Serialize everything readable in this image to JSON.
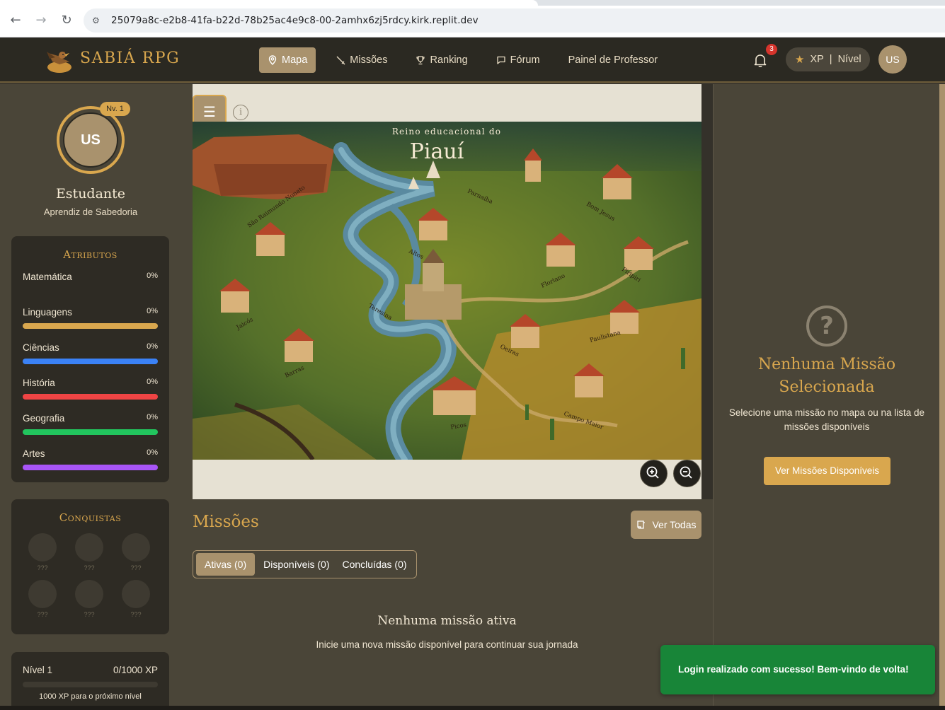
{
  "browser": {
    "url": "25079a8c-e2b8-41fa-b22d-78b25ac4e9c8-00-2amhx6zj5rdcy.kirk.replit.dev"
  },
  "header": {
    "brand": "SABIÁ RPG",
    "nav": [
      {
        "label": "Mapa",
        "icon": "map-pin-icon",
        "active": true
      },
      {
        "label": "Missões",
        "icon": "sword-icon"
      },
      {
        "label": "Ranking",
        "icon": "trophy-icon"
      },
      {
        "label": "Fórum",
        "icon": "chat-icon"
      },
      {
        "label": "Painel de Professor"
      }
    ],
    "notification_count": "3",
    "xp_label": "XP",
    "separator": "|",
    "level_label": "Nível",
    "avatar_initials": "US"
  },
  "profile": {
    "initials": "US",
    "level_badge": "Nv. 1",
    "name": "Estudante",
    "title": "Aprendiz de Sabedoria"
  },
  "attributes": {
    "title": "Atributos",
    "items": [
      {
        "name": "Matemática",
        "pct": "0%",
        "color": ""
      },
      {
        "name": "Linguagens",
        "pct": "0%",
        "color": "#d9a74e"
      },
      {
        "name": "Ciências",
        "pct": "0%",
        "color": "#3b82f6"
      },
      {
        "name": "História",
        "pct": "0%",
        "color": "#ef4444"
      },
      {
        "name": "Geografia",
        "pct": "0%",
        "color": "#22c55e"
      },
      {
        "name": "Artes",
        "pct": "0%",
        "color": "#a855f7"
      }
    ]
  },
  "achievements": {
    "title": "Conquistas",
    "items": [
      "???",
      "???",
      "???",
      "???",
      "???",
      "???"
    ]
  },
  "level": {
    "label": "Nível 1",
    "xp": "0/1000 XP",
    "progress": 0,
    "next": "1000 XP para o próximo nível"
  },
  "map": {
    "subtitle": "Reino educacional do",
    "title": "Piauí",
    "towns": [
      "São Raimundo Nonato",
      "Parnaíba",
      "Bom Jesus",
      "Altos",
      "Floriano",
      "Piripiri",
      "Teresina",
      "Jaicós",
      "Paulistana",
      "Oeiras",
      "Barras",
      "Campo Maior",
      "Picos"
    ]
  },
  "missions": {
    "title": "Missões",
    "ver_todas": "Ver Todas",
    "tabs": [
      {
        "label": "Ativas (0)",
        "active": true
      },
      {
        "label": "Disponíveis (0)"
      },
      {
        "label": "Concluídas (0)"
      }
    ],
    "empty_title": "Nenhuma missão ativa",
    "empty_sub": "Inicie uma nova missão disponível para continuar sua jornada"
  },
  "side": {
    "title_line1": "Nenhuma Missão",
    "title_line2": "Selecionada",
    "subtitle": "Selecione uma missão no mapa ou na lista de missões disponíveis",
    "button": "Ver Missões Disponíveis"
  },
  "toast": {
    "message": "Login realizado com sucesso! Bem-vindo de volta!"
  },
  "colors": {
    "accent": "#d9a74e",
    "button": "#a9926d",
    "header_bg": "#2b2922",
    "panel_bg": "#4a4538",
    "toast_bg": "#188538"
  }
}
